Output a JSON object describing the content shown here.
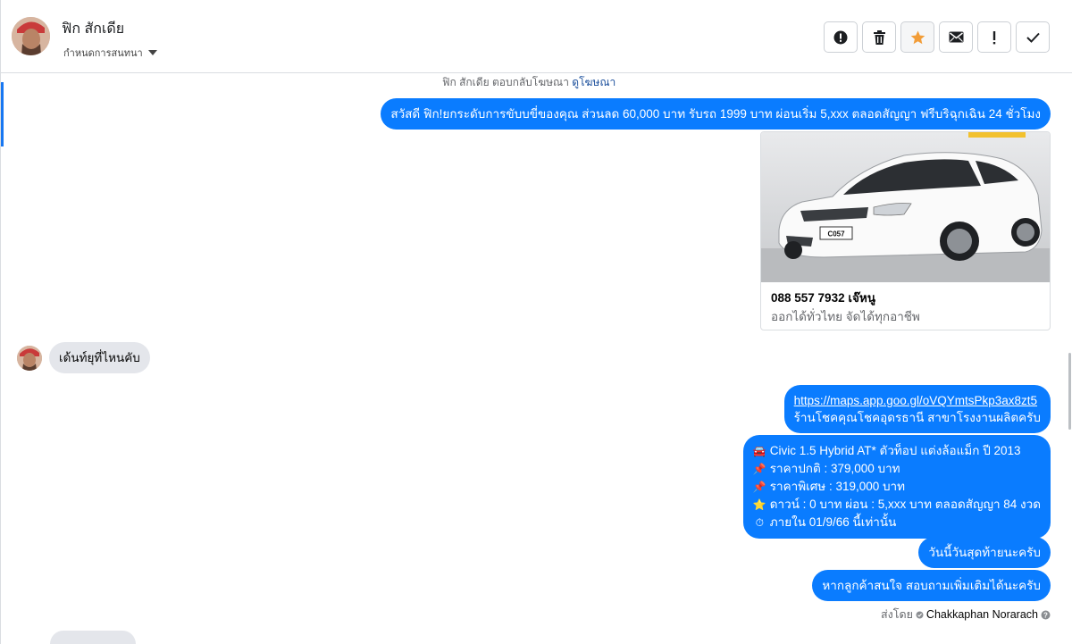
{
  "header": {
    "contact_name": "ฟิก สักเดีย",
    "status_label": "กำหนดการสนทนา",
    "actions": [
      "mark-spam",
      "delete",
      "star",
      "mark-unread",
      "important",
      "done"
    ]
  },
  "thread": {
    "context": {
      "text": "ฟิก สักเดีย ตอบกลับโฆษณา",
      "link": "ดูโฆษณา"
    },
    "ad_message": "สวัสดี ฟิก!ยกระดับการขับบขี่ของคุณ ส่วนลด 60,000 บาท รับรถ 1999 บาท  ผ่อนเริ่ม 5,xxx ตลอดสัญญา ฟรีบริฉุกเฉิน 24 ชั่วโมง",
    "ad_card": {
      "title": "088 557 7932 เจ๊หนู",
      "subtitle": "ออกได้ทั่วไทย จัดได้ทุกอาชีพ",
      "plate": "C057"
    },
    "incoming_message": "เด้นท์ยุที่ไหนคับ",
    "outgoing": {
      "location_link": "https://maps.app.goo.gl/oVQYmtsPkp3ax8zt5",
      "location_text": "ร้านโชคคุณโชคอุดรธานี สาขาโรงงานผลิตครับ",
      "details": [
        {
          "icon": "🚘",
          "text": "Civic 1.5 Hybrid AT* ตัวท็อป แต่งล้อแม็ก ปี 2013"
        },
        {
          "icon": "📌",
          "text": "ราคาปกติ : 379,000 บาท"
        },
        {
          "icon": "📌",
          "text": "ราคาพิเศษ : 319,000 บาท"
        },
        {
          "icon": "⭐",
          "text": "ดาวน์ : 0 บาท ผ่อน : 5,xxx บาท ตลอดสัญญา 84 งวด"
        },
        {
          "icon": "⏱",
          "text": "ภายใน 01/9/66 นี้เท่านั้น"
        }
      ],
      "last_day": "วันนี้วันสุดท้ายนะครับ",
      "follow_up": "หากลูกค้าสนใจ สอบถามเพิ่มเติมได้นะครับ"
    },
    "sent_by_label": "ส่งโดย",
    "sent_by_name": "Chakkaphan Norarach"
  }
}
